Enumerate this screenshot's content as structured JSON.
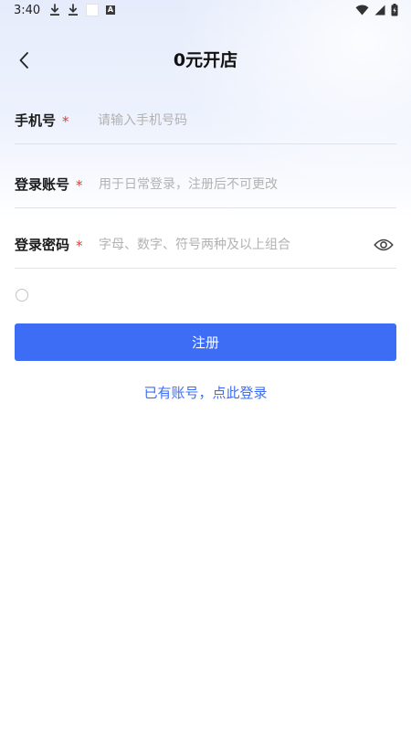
{
  "status_bar": {
    "time": "3:40",
    "icons": [
      "download-icon",
      "download-icon",
      "notification-square",
      "a-badge-icon",
      "wifi-icon",
      "signal-icon",
      "battery-icon"
    ]
  },
  "header": {
    "title": "0元开店",
    "back_icon": "chevron-left-icon"
  },
  "form": {
    "phone": {
      "label": "手机号",
      "required": "*",
      "placeholder": "请输入手机号码",
      "value": ""
    },
    "account": {
      "label": "登录账号",
      "required": "*",
      "placeholder": "用于日常登录，注册后不可更改",
      "value": ""
    },
    "password": {
      "label": "登录密码",
      "required": "*",
      "placeholder": "字母、数字、符号两种及以上组合",
      "value": "",
      "toggle_icon": "eye-icon"
    },
    "agreement_checked": false
  },
  "actions": {
    "register_label": "注册",
    "login_link": "已有账号，点此登录"
  },
  "colors": {
    "primary": "#3d6cf5",
    "required": "#e53935",
    "placeholder": "#b2b2b2",
    "divider": "#e2e2e2"
  }
}
